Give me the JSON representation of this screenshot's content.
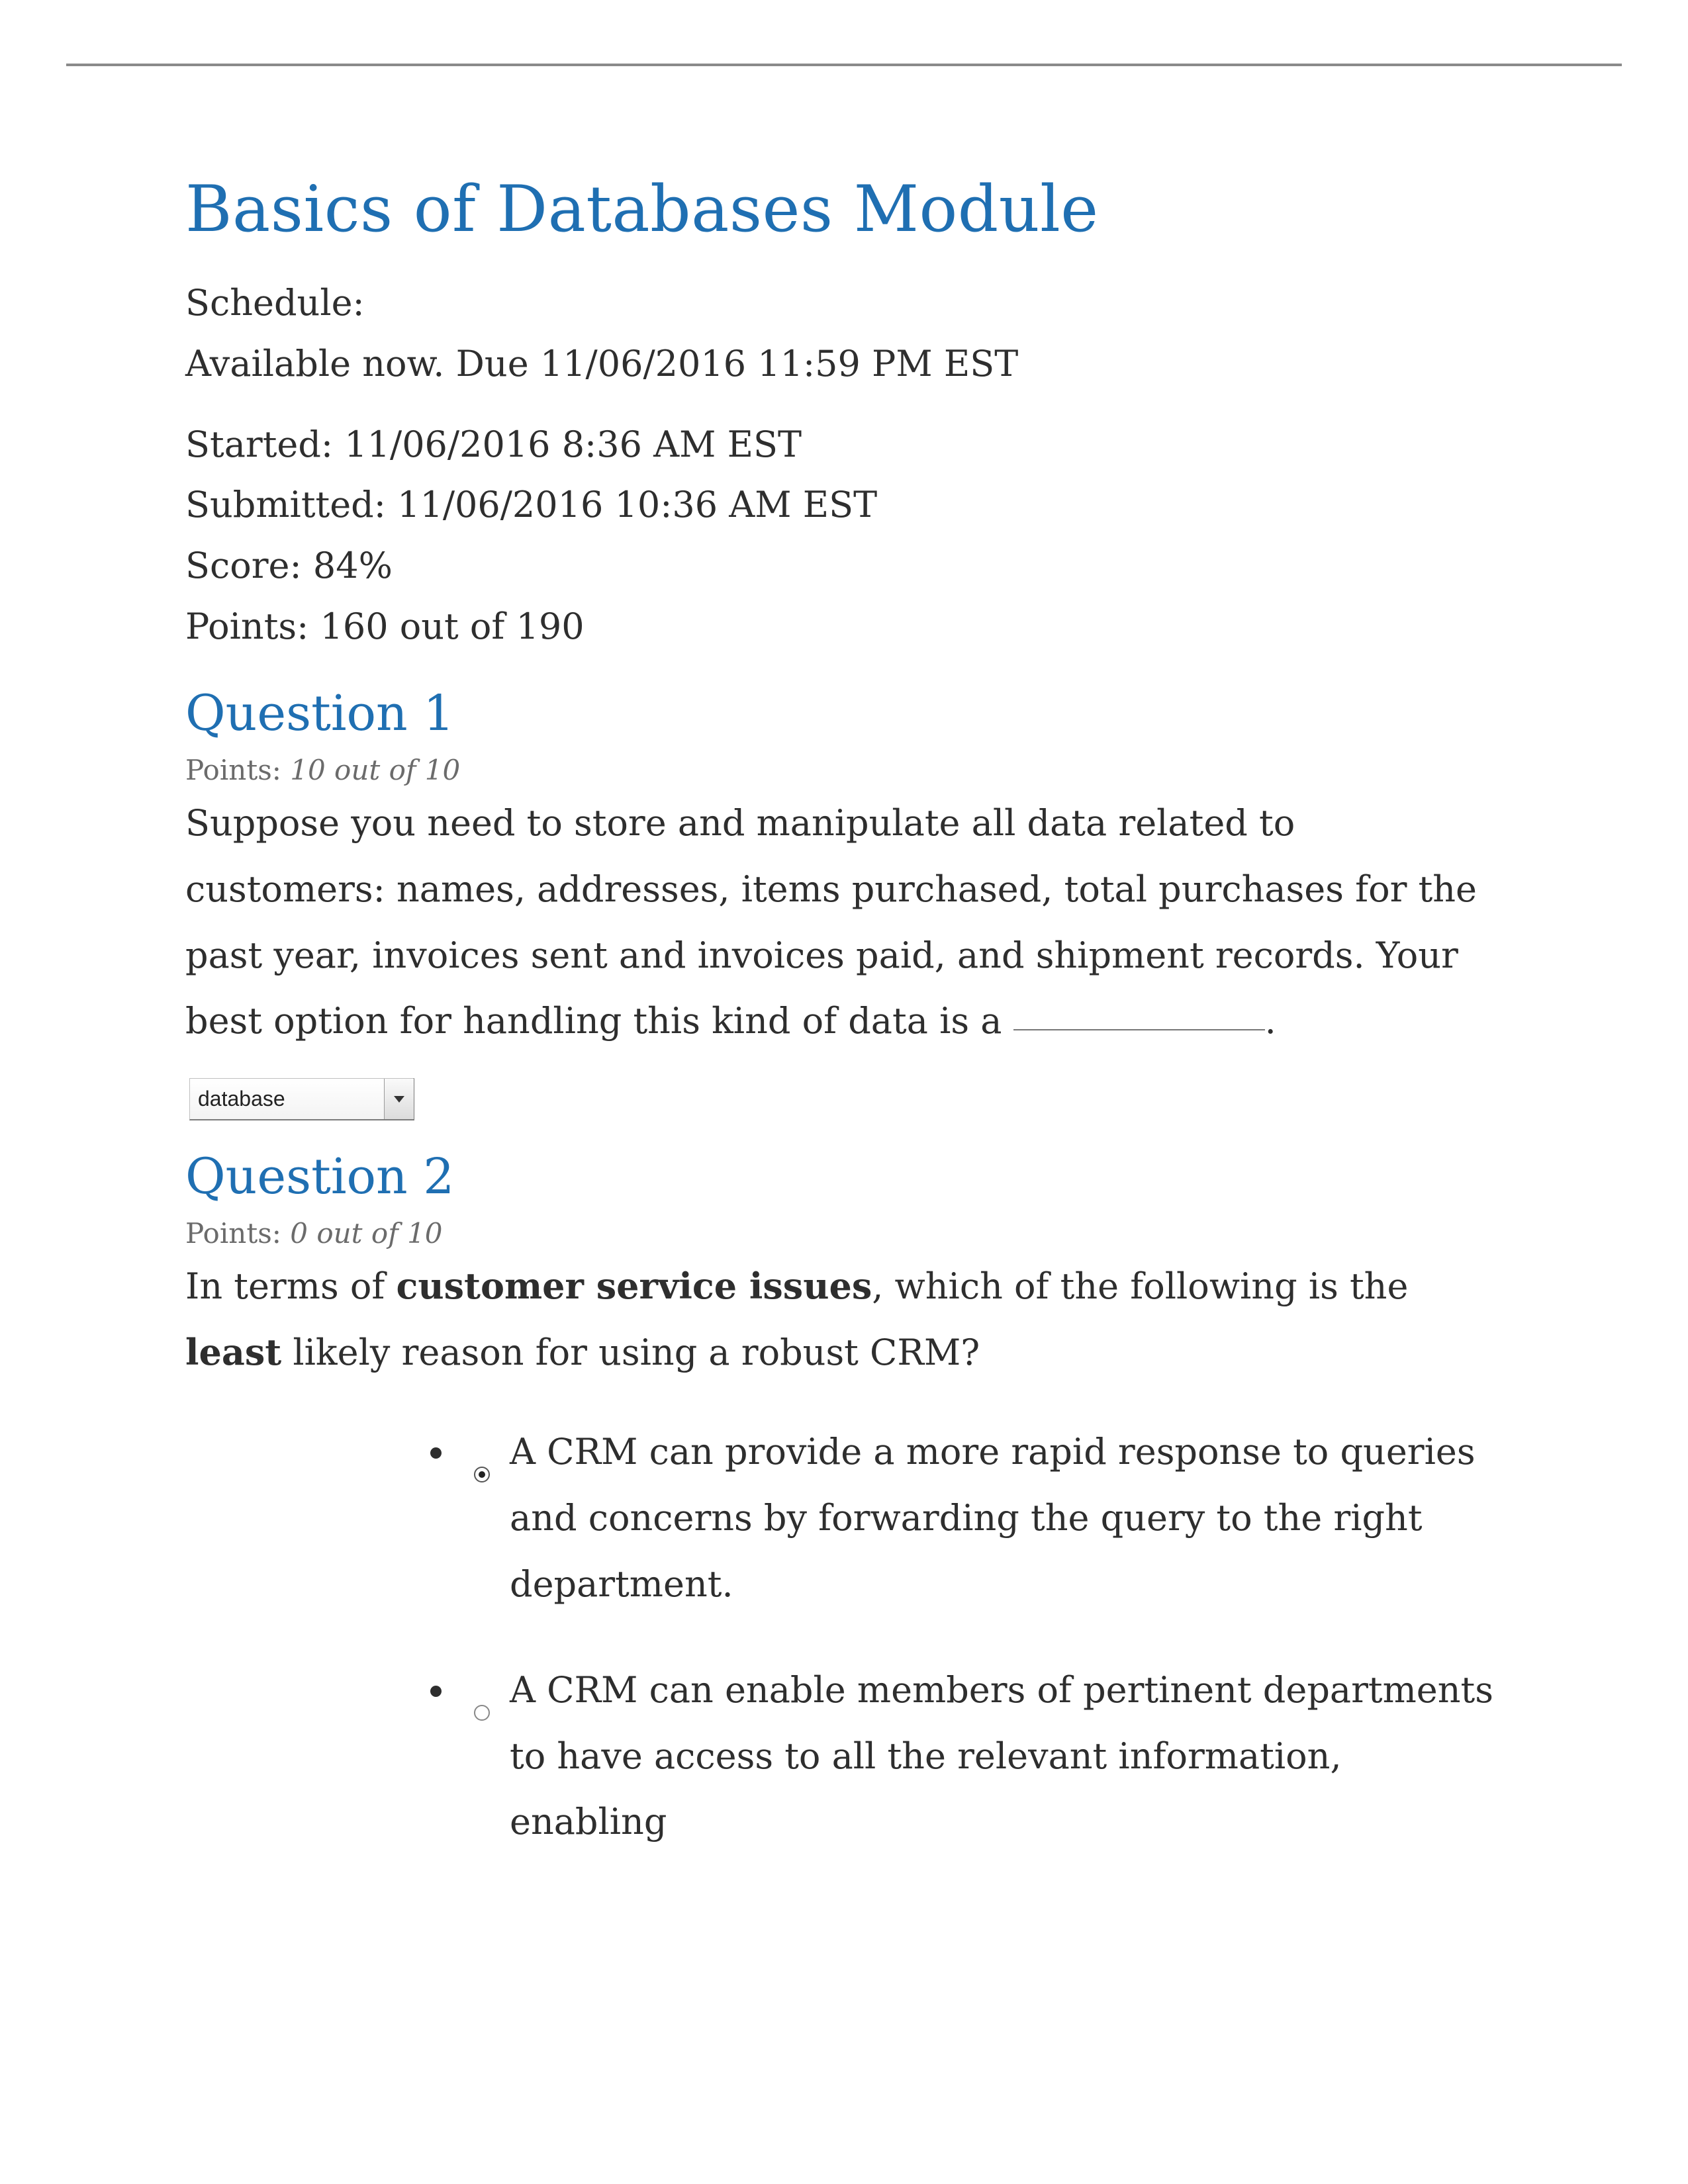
{
  "module": {
    "title": "Basics of Databases Module",
    "schedule_label": "Schedule:",
    "schedule_text": "Available now. Due 11/06/2016 11:59 PM EST",
    "started_label": "Started: ",
    "started_value": "11/06/2016 8:36 AM EST",
    "submitted_label": "Submitted: ",
    "submitted_value": "11/06/2016 10:36 AM EST",
    "score_label": "Score: ",
    "score_value": "84%",
    "points_label": "Points: ",
    "points_value": "160 out of 190"
  },
  "q1": {
    "heading": "Question 1",
    "points_prefix": "Points: ",
    "points_value": "10 out of 10",
    "text_before": "Suppose you need to store and manipulate all data related to customers: names, addresses, items purchased, total purchases for the past year, invoices sent and invoices paid, and shipment records. Your best option for handling this kind of data is a ",
    "dropdown_value": "database",
    "text_after": "."
  },
  "q2": {
    "heading": "Question 2",
    "points_prefix": "Points: ",
    "points_value": "0 out of 10",
    "text_p1": "In terms of ",
    "bold1": "customer service issues",
    "text_p2": ", which of the following is the ",
    "bold2": "least",
    "text_p3": " likely reason for using a robust CRM?",
    "options": [
      {
        "selected": true,
        "text": "A CRM can provide a more rapid response to queries and concerns by forwarding the query to the right department."
      },
      {
        "selected": false,
        "text": "A CRM can enable members of pertinent departments to have access to all the relevant information, enabling"
      }
    ]
  }
}
